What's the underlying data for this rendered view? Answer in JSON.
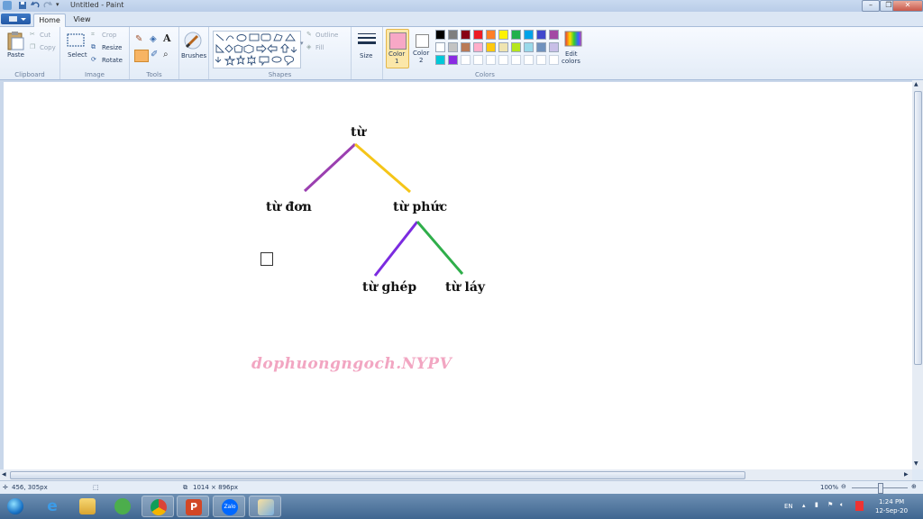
{
  "window": {
    "title": "Untitled - Paint"
  },
  "tabs": {
    "home": "Home",
    "view": "View"
  },
  "clipboard": {
    "paste": "Paste",
    "cut": "Cut",
    "copy": "Copy",
    "group": "Clipboard"
  },
  "image": {
    "select": "Select",
    "crop": "Crop",
    "resize": "Resize",
    "rotate": "Rotate",
    "group": "Image"
  },
  "tools": {
    "group": "Tools",
    "text_tool_glyph": "A"
  },
  "brushes": {
    "label": "Brushes"
  },
  "shapes": {
    "outline": "Outline",
    "fill": "Fill",
    "group": "Shapes"
  },
  "size": {
    "label": "Size"
  },
  "colors": {
    "color1_label": "Color",
    "color1_num": "1",
    "color2_label": "Color",
    "color2_num": "2",
    "edit_label": "Edit",
    "edit_label2": "colors",
    "group": "Colors",
    "color1_value": "#f7a8c6",
    "color2_value": "#ffffff",
    "palette_row1": [
      "#000000",
      "#7f7f7f",
      "#880015",
      "#ed1c24",
      "#ff7f27",
      "#fff200",
      "#22b14c",
      "#00a2e8",
      "#3f48cc",
      "#a349a4"
    ],
    "palette_row2": [
      "#ffffff",
      "#c3c3c3",
      "#b97a57",
      "#ffaec9",
      "#ffc90e",
      "#efe4b0",
      "#b5e61d",
      "#99d9ea",
      "#7092be",
      "#c8bfe7"
    ],
    "palette_row3": [
      "#00c8d8",
      "#8a2be2",
      "",
      "",
      "",
      "",
      "",
      "",
      "",
      ""
    ]
  },
  "canvas": {
    "words": {
      "root": "từ",
      "left": "từ đơn",
      "right": "từ phức",
      "child1": "từ ghép",
      "child2": "từ láy"
    },
    "watermark": "dophuongngoch.NYPV",
    "line_colors": {
      "purple": "#9b3fb0",
      "yellow": "#f5c518",
      "violet": "#7b2be0",
      "green": "#2fae4a"
    }
  },
  "status": {
    "position": "456, 305px",
    "size": "1014 × 896px",
    "zoom": "100%"
  },
  "taskbar": {
    "apps": [
      "start-orb-icon",
      "internet-explorer-icon",
      "file-explorer-icon",
      "messenger-icon",
      "chrome-icon",
      "powerpoint-icon",
      "zalo-icon",
      "paint-icon"
    ],
    "zalo_label": "Zalo",
    "lang": "EN",
    "time": "1:24 PM",
    "date": "12-Sep-20"
  }
}
